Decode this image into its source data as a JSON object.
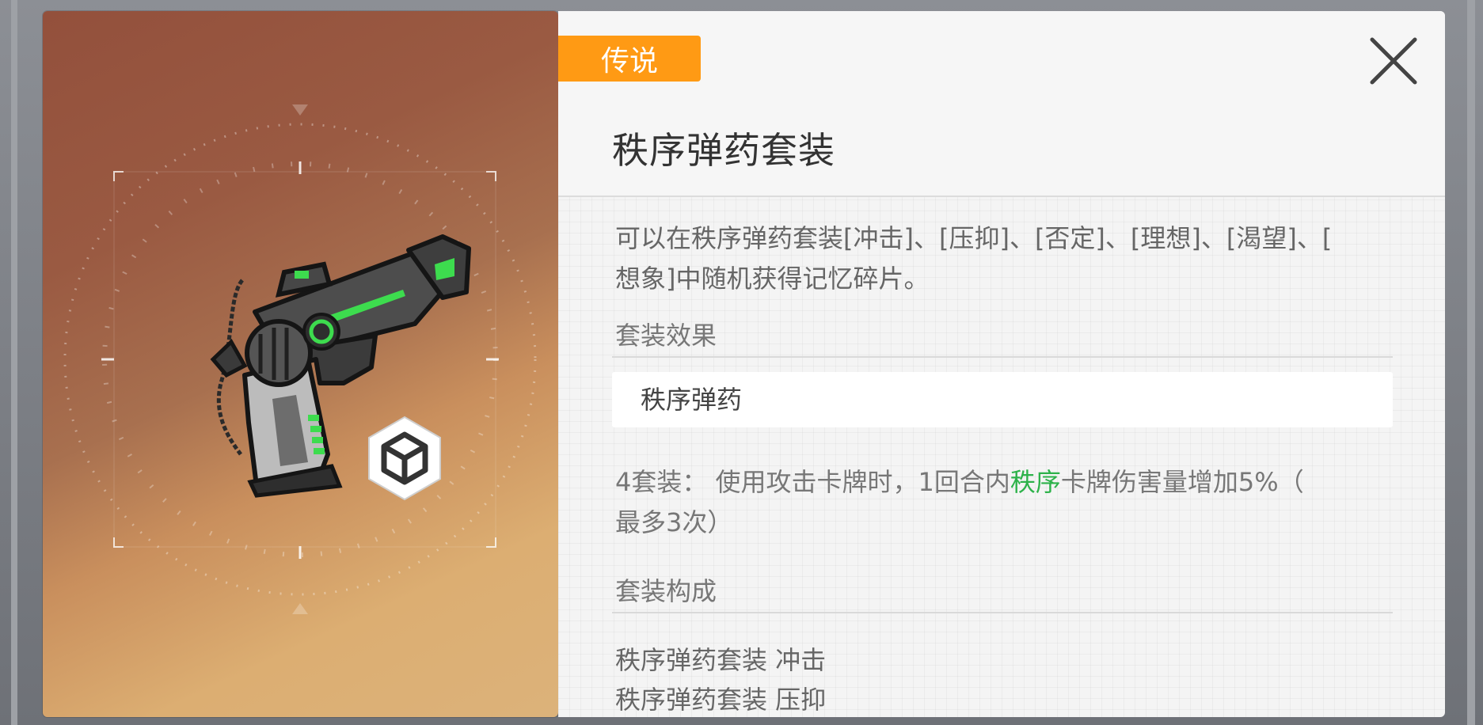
{
  "rarity": {
    "label": "传说",
    "color": "#ff9a14"
  },
  "item": {
    "title": "秩序弹药套装"
  },
  "description": {
    "line1": "可以在秩序弹药套装[冲击]、[压抑]、[否定]、[理想]、[渴望]、[",
    "line2": "想象]中随机获得记忆碎片。"
  },
  "effects": {
    "section_label": "套装效果",
    "set_name": "秩序弹药",
    "bonus_prefix": "4套装：  使用攻击卡牌时，1回合内",
    "bonus_highlight": "秩序",
    "bonus_suffix": "卡牌伤害量增加5%（",
    "bonus_line2": "最多3次）",
    "highlight_color": "#2db24a"
  },
  "composition": {
    "section_label": "套装构成",
    "pieces": [
      "秩序弹药套装 冲击",
      "秩序弹药套装 压抑"
    ]
  },
  "icons": {
    "close": "close-x-icon",
    "item_type": "cube-badge-icon",
    "weapon": "pistol-illustration"
  }
}
